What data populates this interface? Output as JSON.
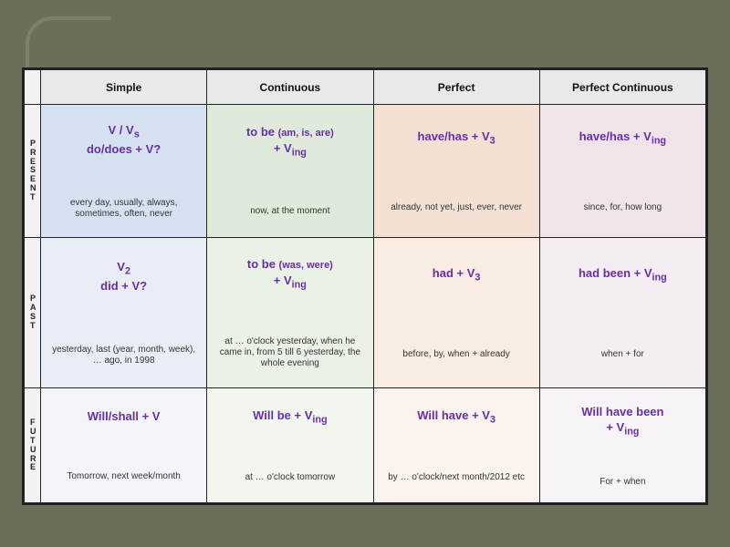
{
  "columns": {
    "simple": "Simple",
    "continuous": "Continuous",
    "perfect": "Perfect",
    "perfect_continuous": "Perfect Continuous"
  },
  "rows": {
    "present": {
      "label": "PRESENT"
    },
    "past": {
      "label": "PAST"
    },
    "future": {
      "label": "FUTURE"
    }
  },
  "cells": {
    "present": {
      "simple": {
        "formula_html": "V / V<sub>s</sub><br>do/does + V?",
        "markers": "every day, usually, always, sometimes, often, never"
      },
      "cont": {
        "formula_html": "to be <span class='aux'>(am, is, are)</span><br>+ V<sub>ing</sub>",
        "markers": "now, at the moment"
      },
      "perf": {
        "formula_html": "have/has + V<sub>3</sub>",
        "markers": "already, not yet, just, ever, never"
      },
      "perfc": {
        "formula_html": "have/has + V<sub>ing</sub>",
        "markers": "since, for, how long"
      }
    },
    "past": {
      "simple": {
        "formula_html": "V<sub>2</sub><br>did + V?",
        "markers": "yesterday, last (year, month, week), … ago, in 1998"
      },
      "cont": {
        "formula_html": "to be <span class='aux'>(was, were)</span><br>+ V<sub>ing</sub>",
        "markers": "at … o'clock yesterday, when he came in, from 5 till 6 yesterday, the whole evening"
      },
      "perf": {
        "formula_html": "had + V<sub>3</sub>",
        "markers": "before, by, when + already"
      },
      "perfc": {
        "formula_html": "had been + V<sub>ing</sub>",
        "markers": "when + for"
      }
    },
    "future": {
      "simple": {
        "formula_html": "Will/shall + V",
        "markers": "Tomorrow, next week/month"
      },
      "cont": {
        "formula_html": "Will be + V<sub>ing</sub>",
        "markers": "at … o'clock tomorrow"
      },
      "perf": {
        "formula_html": "Will have + V<sub>3</sub>",
        "markers": "by … o'clock/next month/2012 etc"
      },
      "perfc": {
        "formula_html": "Will have been<br>+ V<sub>ing</sub>",
        "markers": "For + when"
      }
    }
  }
}
